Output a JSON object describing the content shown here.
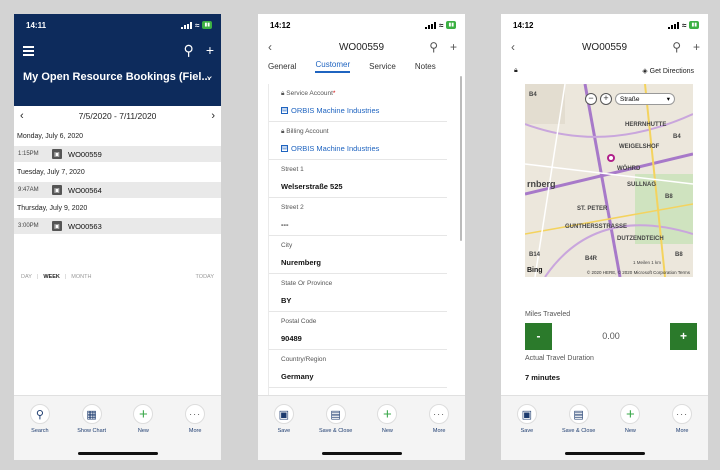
{
  "phone1": {
    "time": "14:11",
    "header_title": "My Open Resource Bookings (Fiel...",
    "date_range": "7/5/2020 - 7/11/2020",
    "days": [
      {
        "label": "Monday, July 6, 2020",
        "time": "1:15PM",
        "wo": "WO00559"
      },
      {
        "label": "Tuesday, July 7, 2020",
        "time": "9:47AM",
        "wo": "WO00564"
      },
      {
        "label": "Thursday, July 9, 2020",
        "time": "3:00PM",
        "wo": "WO00563"
      }
    ],
    "range": {
      "day": "DAY",
      "week": "WEEK",
      "month": "MONTH",
      "today": "TODAY"
    },
    "bottom": {
      "search": "Search",
      "chart": "Show Chart",
      "new": "New",
      "more": "More"
    }
  },
  "phone2": {
    "time": "14:12",
    "title": "WO00559",
    "tabs": [
      "General",
      "Customer",
      "Service",
      "Notes"
    ],
    "fields": {
      "service_account_label": "Service Account",
      "service_account_value": "ORBIS Machine Industries",
      "billing_account_label": "Billing Account",
      "billing_account_value": "ORBIS Machine Industries",
      "street1_label": "Street 1",
      "street1_value": "Welserstraße 525",
      "street2_label": "Street 2",
      "street2_value": "---",
      "city_label": "City",
      "city_value": "Nuremberg",
      "state_label": "State Or Province",
      "state_value": "BY",
      "postal_label": "Postal Code",
      "postal_value": "90489",
      "country_label": "Country/Region",
      "country_value": "Germany"
    },
    "bottom": {
      "save": "Save",
      "save_close": "Save & Close",
      "new": "New",
      "more": "More"
    }
  },
  "phone3": {
    "time": "14:12",
    "title": "WO00559",
    "get_directions": "Get Directions",
    "map": {
      "style": "Straße",
      "labels": [
        "HERRNHUTTE",
        "WEIGELSHOF",
        "WÖHRD",
        "rnberg",
        "SULLNAG",
        "ST. PETER",
        "GUNTHERSSTRASSE",
        "DUTZENDTEICH",
        "B4",
        "B4",
        "B8",
        "B8",
        "B14",
        "B4R"
      ],
      "scale": "1 Meilen 1 km",
      "copyright": "© 2020 HERE, © 2020 Microsoft Corporation  Terms",
      "bing": "Bing"
    },
    "miles_label": "Miles Traveled",
    "miles_value": "0.00",
    "minus": "-",
    "plus": "+",
    "duration_label": "Actual Travel Duration",
    "duration_value": "7 minutes",
    "bottom": {
      "save": "Save",
      "save_close": "Save & Close",
      "new": "New",
      "more": "More"
    }
  }
}
